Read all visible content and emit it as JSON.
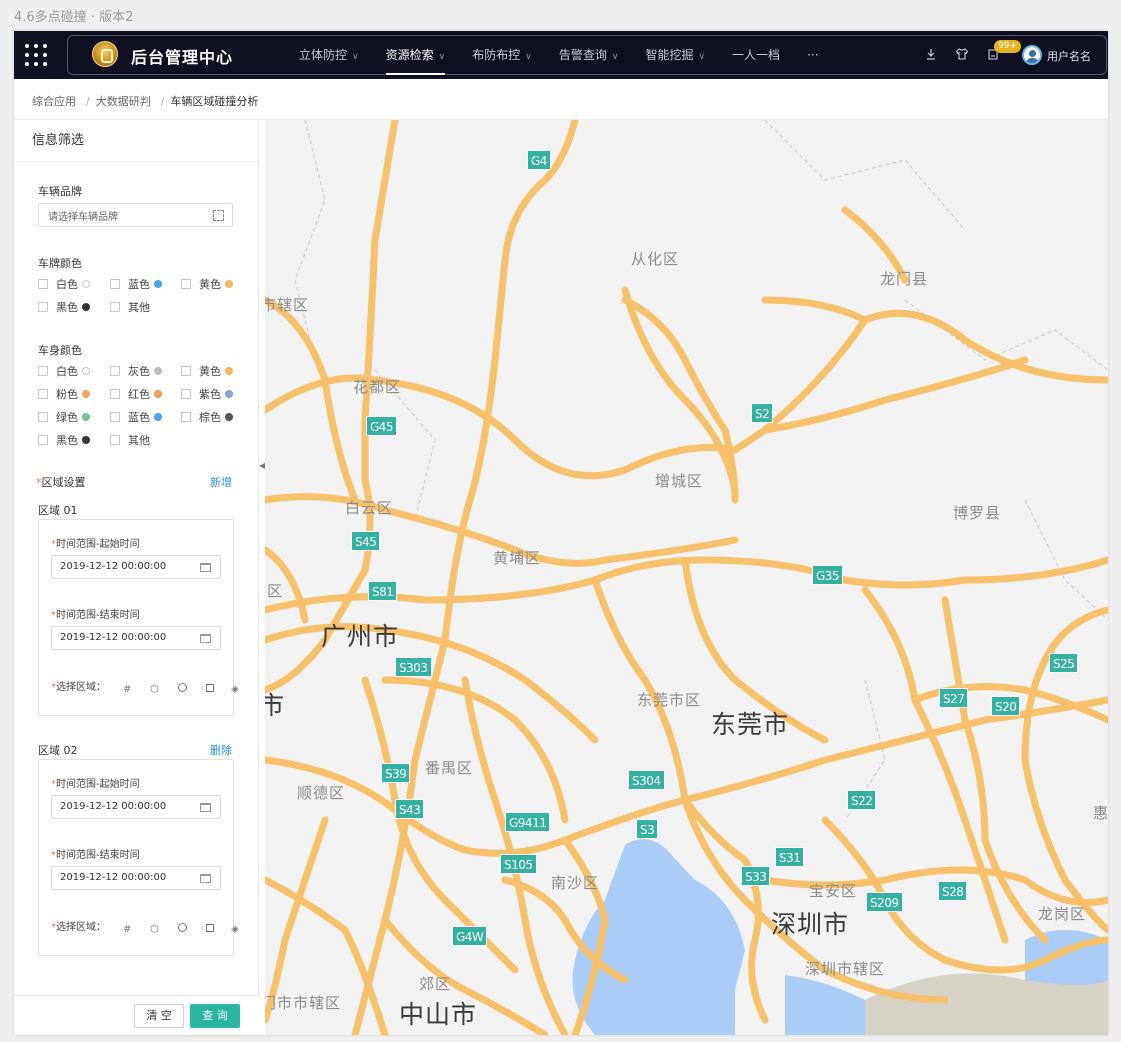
{
  "caption": "4.6多点碰撞 · 版本2",
  "header": {
    "app_title": "后台管理中心",
    "nav": [
      {
        "label": "立体防控",
        "has_menu": true
      },
      {
        "label": "资源检索",
        "has_menu": true,
        "active": true
      },
      {
        "label": "布防布控",
        "has_menu": true
      },
      {
        "label": "告警查询",
        "has_menu": true
      },
      {
        "label": "智能挖掘",
        "has_menu": true
      },
      {
        "label": "一人一档",
        "has_menu": false
      },
      {
        "label": "···",
        "has_menu": false
      }
    ],
    "notification_count": "99+",
    "username": "用户名名",
    "icons": [
      "apps-grid-icon",
      "download-icon",
      "shirt-icon",
      "notification-icon"
    ]
  },
  "breadcrumb": [
    "综合应用",
    "大数据研判",
    "车辆区域碰撞分析"
  ],
  "filter": {
    "title": "信息筛选",
    "brand_label": "车辆品牌",
    "brand_placeholder": "请选择车辆品牌",
    "plate_color_label": "车牌颜色",
    "plate_colors": [
      {
        "label": "白色",
        "color": "#ffffff"
      },
      {
        "label": "蓝色",
        "color": "#4aa3f0"
      },
      {
        "label": "黄色",
        "color": "#f5b75a"
      },
      {
        "label": "黑色",
        "color": "#333333"
      },
      {
        "label": "其他",
        "color": ""
      }
    ],
    "body_color_label": "车身颜色",
    "body_colors": [
      {
        "label": "白色",
        "color": "#ffffff"
      },
      {
        "label": "灰色",
        "color": "#bdbdbd"
      },
      {
        "label": "黄色",
        "color": "#f5b75a"
      },
      {
        "label": "粉色",
        "color": "#f3a46b"
      },
      {
        "label": "红色",
        "color": "#f29a58"
      },
      {
        "label": "紫色",
        "color": "#8aa0d0"
      },
      {
        "label": "绿色",
        "color": "#7bbf8a"
      },
      {
        "label": "蓝色",
        "color": "#4aa3f0"
      },
      {
        "label": "棕色",
        "color": "#555555"
      },
      {
        "label": "黑色",
        "color": "#333333"
      },
      {
        "label": "其他",
        "color": ""
      }
    ],
    "region_label": "区域设置",
    "add_label": "新增",
    "regions": [
      {
        "name": "区域 01",
        "action": "",
        "start_label": "时间范围-起始时间",
        "start_value": "2019-12-12  00:00:00",
        "end_label": "时间范围-结束时间",
        "end_value": "2019-12-12  00:00:00",
        "area_label": "选择区域："
      },
      {
        "name": "区域 02",
        "action": "删除",
        "start_label": "时间范围-起始时间",
        "start_value": "2019-12-12  00:00:00",
        "end_label": "时间范围-结束时间",
        "end_value": "2019-12-12  00:00:00",
        "area_label": "选择区域："
      }
    ],
    "clear_label": "清 空",
    "query_label": "查 询"
  },
  "map": {
    "road_color": "#f7c06b",
    "water_color": "#a9cdf7",
    "shields": [
      "G4",
      "G45",
      "S2",
      "S45",
      "S81",
      "G35",
      "S303",
      "S25",
      "S27",
      "S20",
      "S39",
      "S304",
      "S43",
      "G9411",
      "S3",
      "S22",
      "S31",
      "S105",
      "S33",
      "S209",
      "S28",
      "G4W"
    ],
    "districts": [
      "从化区",
      "龙门县",
      "市辖区",
      "花都区",
      "增城区",
      "博罗县",
      "白云区",
      "黄埔区",
      "东莞市区",
      "番禺区",
      "顺德区",
      "南沙区",
      "宝安区",
      "龙岗区",
      "深圳市辖区",
      "郊区",
      "门市市辖区",
      "区",
      "惠"
    ],
    "cities": [
      "广州市",
      "东莞市",
      "深圳市",
      "中山市",
      "市"
    ]
  }
}
